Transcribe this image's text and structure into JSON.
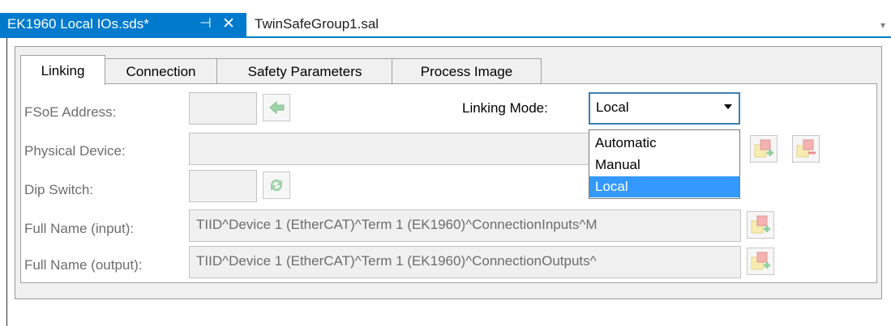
{
  "document_tabs": [
    {
      "label": "EK1960 Local IOs.sds*",
      "pin_glyph": "⊣",
      "close_glyph": "✕",
      "active": true
    },
    {
      "label": "TwinSafeGroup1.sal",
      "active": false
    }
  ],
  "tabstrip": {
    "overflow_glyph": "▾"
  },
  "inner_tabs": [
    "Linking",
    "Connection",
    "Safety Parameters",
    "Process Image"
  ],
  "form": {
    "fsoe_address": {
      "label": "FSoE Address:",
      "value": ""
    },
    "physical_device": {
      "label": "Physical Device:",
      "value": ""
    },
    "dip_switch": {
      "label": "Dip Switch:",
      "value": ""
    },
    "full_name_input": {
      "label": "Full Name (input):",
      "value": "TIID^Device 1 (EtherCAT)^Term 1 (EK1960)^ConnectionInputs^M"
    },
    "full_name_output": {
      "label": "Full Name (output):",
      "value": "TIID^Device 1 (EtherCAT)^Term 1 (EK1960)^ConnectionOutputs^"
    }
  },
  "linking_mode": {
    "label": "Linking Mode:",
    "selected": "Local",
    "options": [
      "Automatic",
      "Manual",
      "Local"
    ]
  },
  "colors": {
    "accent": "#007acc",
    "selection": "#3399ff"
  },
  "icons": [
    "pin-icon",
    "close-icon",
    "arrow-left-icon",
    "refresh-icon",
    "add-device-icon",
    "remove-device-icon"
  ]
}
